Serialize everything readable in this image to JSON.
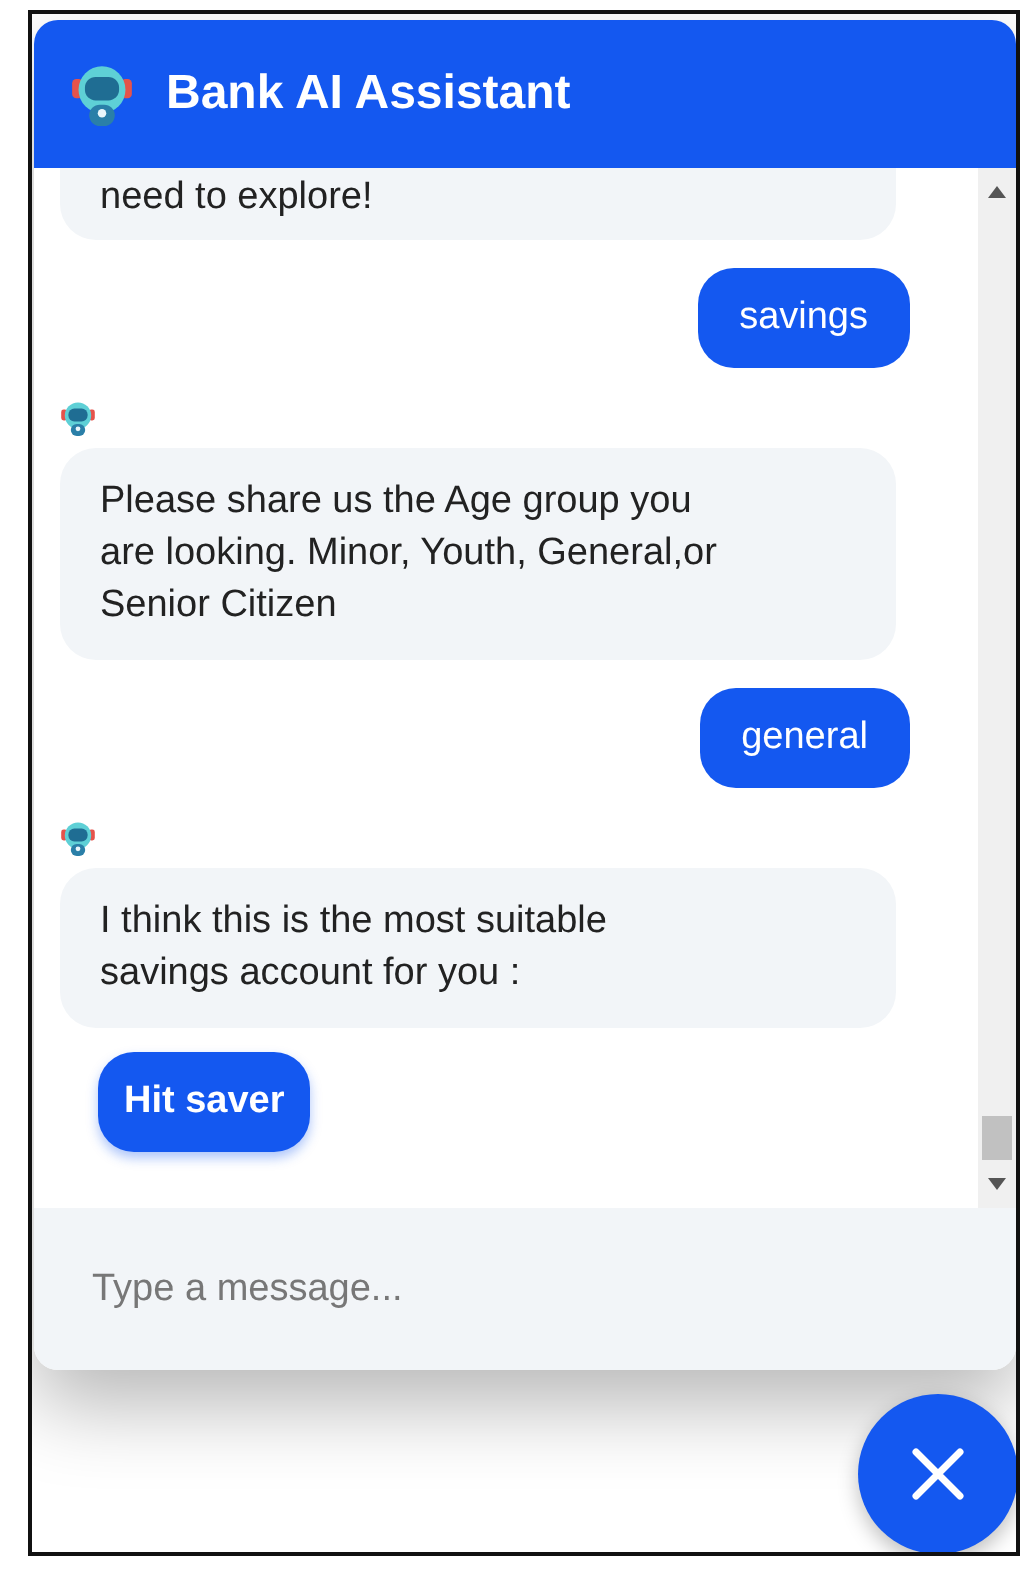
{
  "header": {
    "title": "Bank AI Assistant"
  },
  "messages": [
    {
      "kind": "bot_cut",
      "text": "need to explore!"
    },
    {
      "kind": "user",
      "text": "savings"
    },
    {
      "kind": "bot",
      "text": "Please share us the Age group you are looking. Minor, Youth, General,or Senior Citizen"
    },
    {
      "kind": "user",
      "text": "general"
    },
    {
      "kind": "bot",
      "text": "I think this is the most suitable savings account for you :"
    },
    {
      "kind": "option",
      "text": "Hit saver"
    }
  ],
  "composer": {
    "placeholder": "Type a message..."
  }
}
